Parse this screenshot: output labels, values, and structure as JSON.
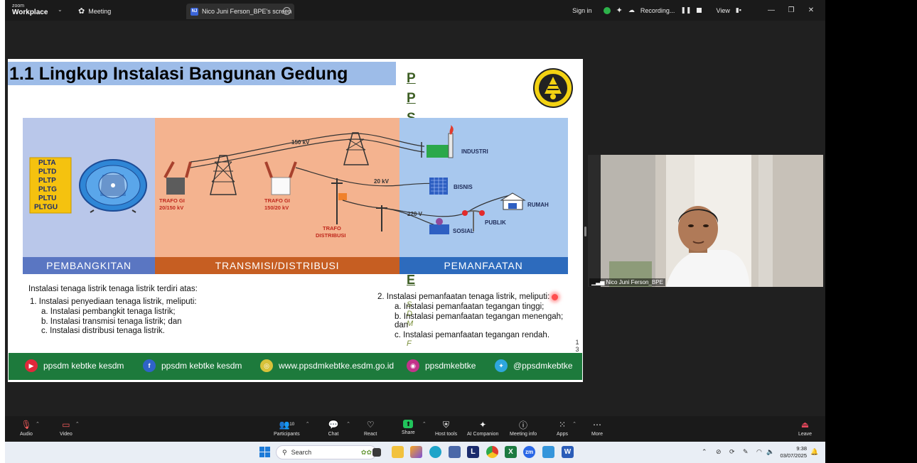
{
  "titlebar": {
    "brand_small": "zoom",
    "brand_big": "Workplace",
    "meeting_label": "Meeting",
    "share_initials": "NJ",
    "share_tab_label": "Nico Juni Ferson_BPE's screen",
    "sign_in": "Sign in",
    "recording_label": "Recording...",
    "view_label": "View"
  },
  "slide": {
    "title": "1.1 Lingkup Instalasi Bangunan Gedung",
    "pps_letters": [
      "P",
      "P",
      "S"
    ],
    "overlay_letters": [
      "E",
      "S",
      "D",
      "M",
      "F"
    ],
    "generators": [
      "PLTA",
      "PLTD",
      "PLTP",
      "PLTG",
      "PLTU",
      "PLTGU"
    ],
    "section_labels": [
      "PEMBANGKITAN",
      "TRANSMISI/DISTRIBUSI",
      "PEMANFAATAN"
    ],
    "diagram_labels": {
      "kv150": "150 kV",
      "kv20": "20 kV",
      "v220": "220 V",
      "trafo_gi_1": "TRAFO GI",
      "trafo_gi_1_sub": "20/150 kV",
      "trafo_gi_2": "TRAFO GI",
      "trafo_gi_2_sub": "150/20 kV",
      "trafo_dist": "TRAFO",
      "trafo_dist_sub": "DISTRIBUSI",
      "industri": "INDUSTRI",
      "bisnis": "BISNIS",
      "rumah": "RUMAH",
      "publik": "PUBLIK",
      "sosial": "SOSIAL"
    },
    "left_intro": "Instalasi tenaga listrik tenaga listrik terdiri atas:",
    "left_item1": "1.   Instalasi penyediaan tenaga listrik, meliputi:",
    "left_subitems": [
      "a.   Instalasi pembangkit tenaga listrik;",
      "b.   Instalasi transmisi tenaga listrik; dan",
      "c.   Instalasi distribusi tenaga listrik."
    ],
    "right_item2": "2.    Instalasi pemanfaatan tenaga listrik, meliputi:",
    "right_subitems": [
      "a.   Instalasi pemanfaatan tegangan tinggi;",
      "b.   Instalasi pemanfaatan tegangan menengah;",
      "      dan",
      "c.   Instalasi pemanfaatan tegangan rendah."
    ],
    "page_number": [
      "1",
      "3"
    ],
    "footer": [
      {
        "icon": "youtube-icon",
        "label": "ppsdm kebtke kesdm",
        "color": "#e0283a"
      },
      {
        "icon": "facebook-icon",
        "label": "ppsdm kebtke kesdm",
        "color": "#2f63c7"
      },
      {
        "icon": "web-icon",
        "label": "www.ppsdmkebtke.esdm.go.id",
        "color": "#d8c23a"
      },
      {
        "icon": "instagram-icon",
        "label": "ppsdmkebtke",
        "color": "#c2338a"
      },
      {
        "icon": "twitter-icon",
        "label": "@ppsdmkebtke",
        "color": "#2ea7dd"
      }
    ]
  },
  "video": {
    "participant_name": "Nico Juni Ferson_BPE"
  },
  "toolbar": {
    "audio": "Audio",
    "video": "Video",
    "participants": "Participants",
    "participants_count": "10",
    "chat": "Chat",
    "react": "React",
    "share": "Share",
    "host_tools": "Host tools",
    "ai_companion": "AI Companion",
    "meeting_info": "Meeting info",
    "apps": "Apps",
    "more": "More",
    "leave": "Leave"
  },
  "taskbar": {
    "search_placeholder": "Search",
    "time": "9:38",
    "date": "03/07/2025"
  }
}
